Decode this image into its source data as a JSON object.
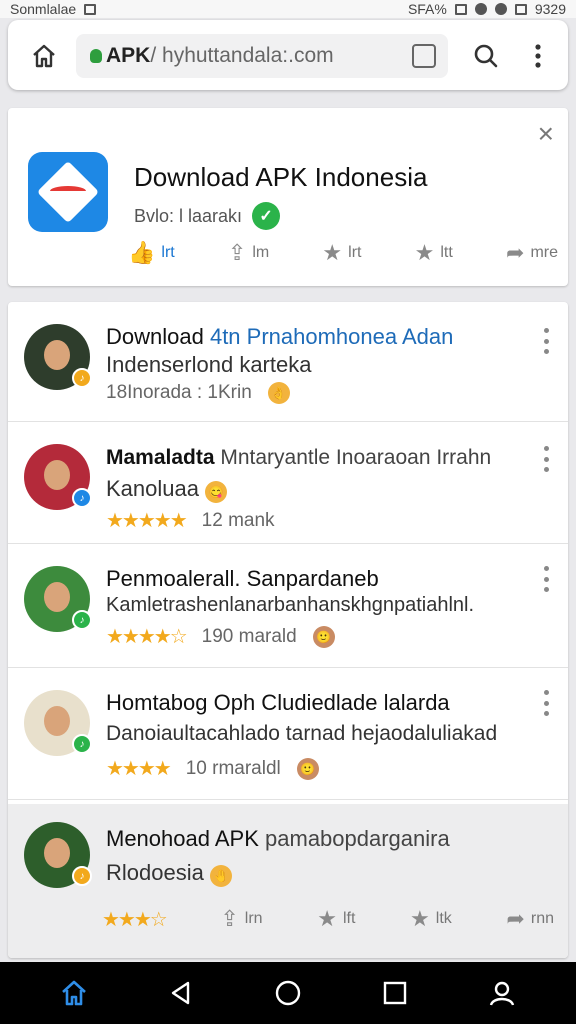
{
  "status_bar": {
    "left_text": "Sonmlalae",
    "right_text": "SFA%",
    "time": "9329"
  },
  "browser": {
    "url_bold": "APK",
    "url_rest": " / hyhuttandala:.com"
  },
  "app_card": {
    "title": "Download APK Indonesia",
    "subtitle": "Bvlo: l laarakı",
    "verified_glyph": "✓",
    "close_glyph": "×",
    "actions": [
      {
        "icon": "like-icon",
        "glyph": "👍",
        "label": "lrt"
      },
      {
        "icon": "share-icon",
        "glyph": "⇪",
        "label": "lm"
      },
      {
        "icon": "star-icon",
        "glyph": "★",
        "label": "lrt"
      },
      {
        "icon": "star-icon",
        "glyph": "★",
        "label": "ltt"
      },
      {
        "icon": "forward-icon",
        "glyph": "➦",
        "label": "mre"
      }
    ]
  },
  "feed": {
    "items": [
      {
        "title_black": "Download ",
        "title_blue": "4tn Prnahomhonea Adan",
        "line2": "Indenserlond karteka",
        "meta": "18Inorada  : 1Krin",
        "stars": "",
        "emoji": "👌",
        "avatar_bg": "#2e3d2c",
        "badge_color": "#f2a91d"
      },
      {
        "title_black": "Mamaladta ",
        "title_blue": "",
        "title_rest": "Mntaryantle Inoaraoan Irrahn",
        "line2": "Kanoluaa",
        "meta": "12 mank",
        "stars": "★★★★★",
        "emoji": "😋",
        "avatar_bg": "#b42a3a",
        "badge_color": "#1e88e5"
      },
      {
        "title_black": "Penmoalerall. Sanpardaneb",
        "title_blue": "",
        "line2": "Kamletrashenlanarbanhanskhgnpatiahlnl.",
        "meta": "190 marald",
        "stars": "★★★★☆",
        "emoji": "🙂",
        "avatar_bg": "#3d8b3d",
        "badge_color": "#2bb34a"
      },
      {
        "title_black": "Homtabog Oph Cludiedlade lalarda",
        "title_blue": "",
        "line2": "Danoiaultacahlado tarnad hejaodaluliakad",
        "meta": "10 rmaraldl",
        "stars": "★★★★",
        "emoji": "🙂",
        "avatar_bg": "#e8e0cc",
        "badge_color": "#2bb34a"
      },
      {
        "title_black": "Menohoad APK ",
        "title_blue": "",
        "title_rest": "pamabopdarganira",
        "line2": "Rlodoesia",
        "meta": "",
        "stars": "",
        "emoji": "🤚",
        "avatar_bg": "#2d5e2b",
        "badge_color": "#f2a91d"
      }
    ],
    "actions": [
      {
        "icon": "star-rating-icon",
        "glyph": "★★★☆",
        "label": ""
      },
      {
        "icon": "share-icon",
        "glyph": "⇪",
        "label": "lrn"
      },
      {
        "icon": "star-icon",
        "glyph": "★",
        "label": "lft"
      },
      {
        "icon": "star-icon",
        "glyph": "★",
        "label": "ltk"
      },
      {
        "icon": "forward-icon",
        "glyph": "➦",
        "label": "rnn"
      }
    ]
  },
  "colors": {
    "accent": "#1976d2",
    "link": "#1e6bb8",
    "star": "#f2a91d",
    "verified": "#2bb34a"
  }
}
